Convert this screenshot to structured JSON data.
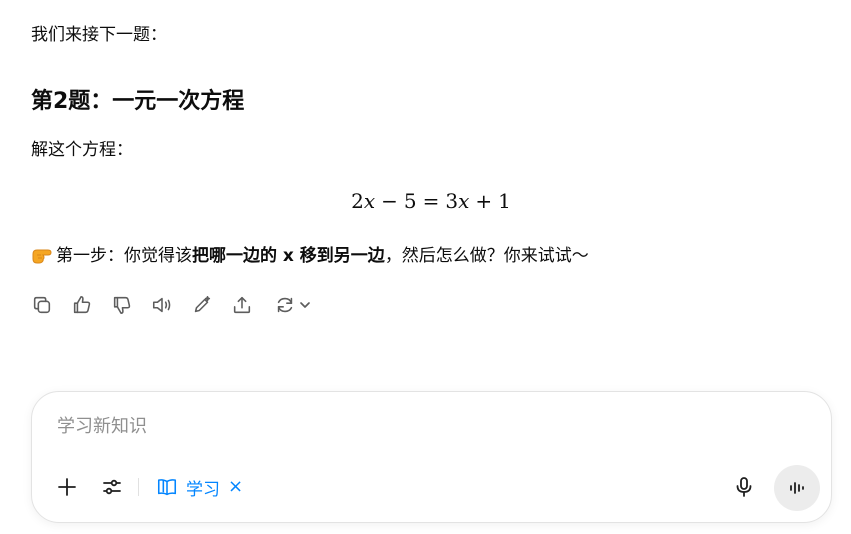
{
  "conversation": {
    "intro": "我们来接下一题：",
    "heading": "第2题：一元一次方程",
    "instruction": "解这个方程：",
    "equation": {
      "left_coef": "2",
      "left_var": "x",
      "minus": "−",
      "left_const": "5",
      "equals": "=",
      "right_coef": "3",
      "right_var": "x",
      "plus": "+",
      "right_const": "1"
    },
    "step": {
      "emoji_icon": "pointing-hand-icon",
      "prefix": "第一步：你觉得该",
      "bold_text": "把哪一边的 x 移到另一边",
      "suffix": "，然后怎么做？你来试试～"
    }
  },
  "actions": {
    "icons": [
      "copy-icon",
      "thumbs-up-icon",
      "thumbs-down-icon",
      "read-aloud-icon",
      "edit-icon",
      "share-icon",
      "regenerate-icon"
    ]
  },
  "composer": {
    "placeholder": "学习新知识",
    "chip_label": "学习",
    "chip_close": "×",
    "accent_color": "#0285ff"
  }
}
